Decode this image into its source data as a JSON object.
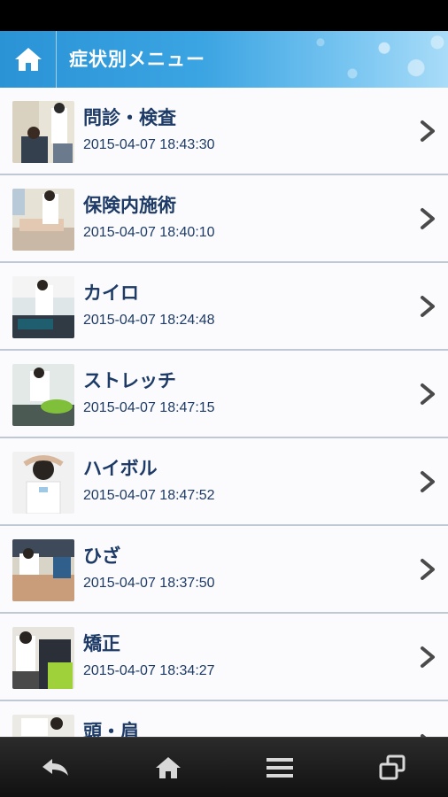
{
  "header": {
    "title": "症状別メニュー",
    "home_icon": "home-icon"
  },
  "items": [
    {
      "title": "問診・検査",
      "date": "2015-04-07 18:43:30"
    },
    {
      "title": "保険内施術",
      "date": "2015-04-07 18:40:10"
    },
    {
      "title": "カイロ",
      "date": "2015-04-07 18:24:48"
    },
    {
      "title": "ストレッチ",
      "date": "2015-04-07 18:47:15"
    },
    {
      "title": "ハイボル",
      "date": "2015-04-07 18:47:52"
    },
    {
      "title": "ひざ",
      "date": "2015-04-07 18:37:50"
    },
    {
      "title": "矯正",
      "date": "2015-04-07 18:34:27"
    },
    {
      "title": "頭・肩",
      "date": ""
    }
  ],
  "bottom_nav": [
    "back-icon",
    "home-icon",
    "menu-icon",
    "windows-icon"
  ],
  "colors": {
    "header_accent": "#3ba4e2",
    "title_text": "#1d3b66",
    "divider": "#bfc9d6",
    "nav_bg": "#1a1a1a"
  }
}
